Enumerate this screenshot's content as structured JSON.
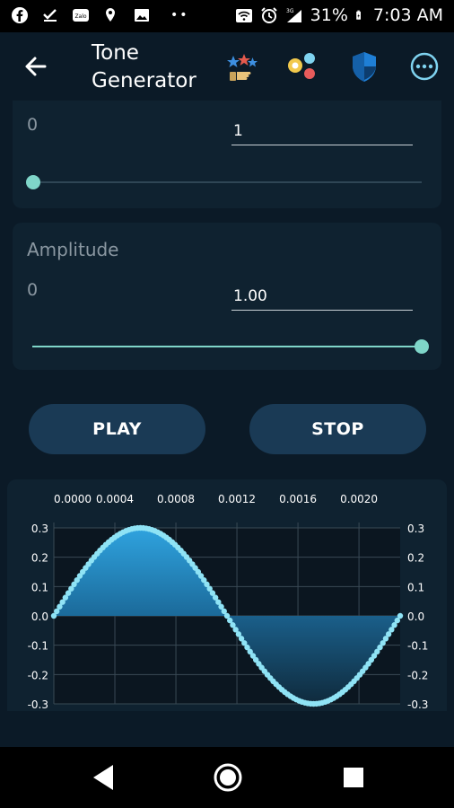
{
  "status_bar": {
    "battery": "31%",
    "time": "7:03 AM",
    "network": "3G",
    "left_icons": [
      "facebook-icon",
      "check-list-icon",
      "zalo-icon",
      "location-icon",
      "image-icon"
    ],
    "right_icons": [
      "wifi-icon",
      "alarm-icon",
      "signal-icon",
      "battery-icon"
    ]
  },
  "app_bar": {
    "title": "Tone Generator",
    "icons": [
      "rate-app-icon",
      "color-picker-icon",
      "shield-icon",
      "more-options-icon"
    ]
  },
  "frequency_card": {
    "min_label": "0",
    "value": "1",
    "slider_fraction": 0
  },
  "amplitude_card": {
    "title": "Amplitude",
    "min_label": "0",
    "value": "1.00",
    "slider_fraction": 1
  },
  "buttons": {
    "play_label": "PLAY",
    "stop_label": "STOP"
  },
  "colors": {
    "background": "#0b1a27",
    "card": "#0f2230",
    "accent": "#7fd6c9",
    "button": "#1a3a55",
    "wave": "#8fe3f5",
    "fill": "#2fa3df"
  },
  "chart_data": {
    "type": "area",
    "x_ticks": [
      "0.0000",
      "0.0004",
      "0.0008",
      "0.0012",
      "0.0016",
      "0.0020"
    ],
    "y_ticks": [
      "0.3",
      "0.2",
      "0.1",
      "0.0",
      "-0.1",
      "-0.2",
      "-0.3"
    ],
    "xlim": [
      0,
      0.00227
    ],
    "ylim": [
      -0.3,
      0.3
    ],
    "amplitude": 0.3,
    "period": 0.00227,
    "grid": true,
    "legend": "none"
  },
  "nav_bar": {
    "buttons": [
      "back-icon",
      "home-icon",
      "recents-icon"
    ]
  }
}
